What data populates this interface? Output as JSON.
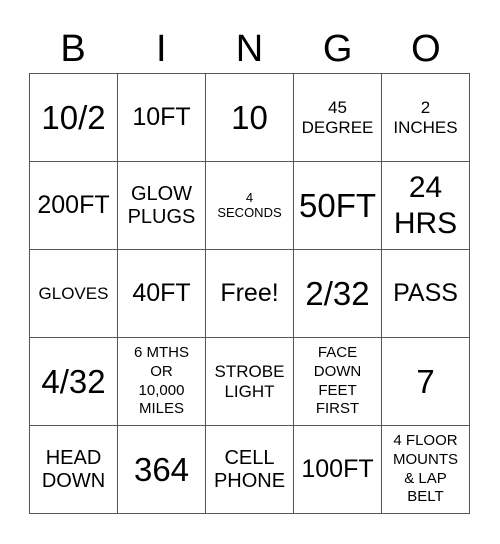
{
  "header": [
    "B",
    "I",
    "N",
    "G",
    "O"
  ],
  "cells": [
    {
      "text": "10/2",
      "size": "s-xl"
    },
    {
      "text": "10FT",
      "size": "s-m"
    },
    {
      "text": "10",
      "size": "s-xl"
    },
    {
      "text": "45\nDEGREE",
      "size": "s-s"
    },
    {
      "text": "2\nINCHES",
      "size": "s-s"
    },
    {
      "text": "200FT",
      "size": "s-m"
    },
    {
      "text": "GLOW\nPLUGS",
      "size": "s-sm"
    },
    {
      "text": "4\nSECONDS",
      "size": "s-xxs"
    },
    {
      "text": "50FT",
      "size": "s-xl"
    },
    {
      "text": "24\nHRS",
      "size": "s-l"
    },
    {
      "text": "GLOVES",
      "size": "s-s"
    },
    {
      "text": "40FT",
      "size": "s-m"
    },
    {
      "text": "Free!",
      "size": "s-m"
    },
    {
      "text": "2/32",
      "size": "s-xl"
    },
    {
      "text": "PASS",
      "size": "s-m"
    },
    {
      "text": "4/32",
      "size": "s-xl"
    },
    {
      "text": "6 MTHS\nOR\n10,000\nMILES",
      "size": "s-xs"
    },
    {
      "text": "STROBE\nLIGHT",
      "size": "s-s"
    },
    {
      "text": "FACE\nDOWN\nFEET\nFIRST",
      "size": "s-xs"
    },
    {
      "text": "7",
      "size": "s-xl"
    },
    {
      "text": "HEAD\nDOWN",
      "size": "s-sm"
    },
    {
      "text": "364",
      "size": "s-xl"
    },
    {
      "text": "CELL\nPHONE",
      "size": "s-sm"
    },
    {
      "text": "100FT",
      "size": "s-m"
    },
    {
      "text": "4 FLOOR\nMOUNTS\n& LAP\nBELT",
      "size": "s-xs"
    }
  ]
}
